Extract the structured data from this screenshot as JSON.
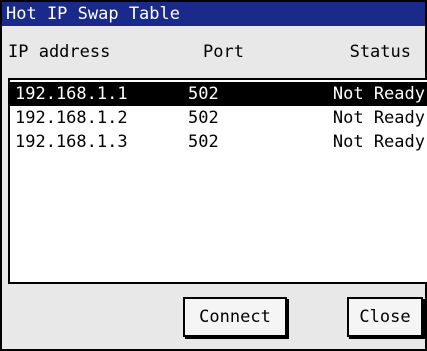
{
  "window": {
    "title": "Hot IP Swap Table"
  },
  "table": {
    "headers": {
      "ip": "IP address",
      "port": "Port",
      "status": "Status"
    },
    "rows": [
      {
        "ip": "192.168.1.1",
        "port": "502",
        "status": "Not Ready",
        "selected": true
      },
      {
        "ip": "192.168.1.2",
        "port": "502",
        "status": "Not Ready",
        "selected": false
      },
      {
        "ip": "192.168.1.3",
        "port": "502",
        "status": "Not Ready",
        "selected": false
      }
    ]
  },
  "buttons": {
    "connect_label": "Connect",
    "close_label": "Close"
  },
  "colors": {
    "titlebar": "#1a2a8a",
    "selection": "#000000"
  }
}
